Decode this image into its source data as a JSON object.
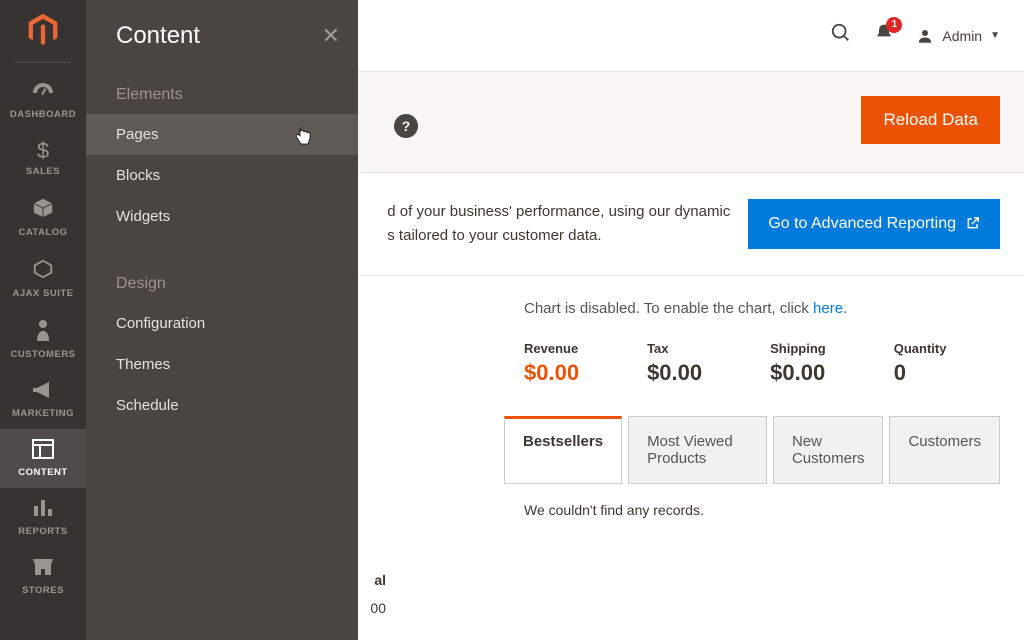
{
  "rail": {
    "items": [
      {
        "label": "DASHBOARD",
        "icon": "◐"
      },
      {
        "label": "SALES",
        "icon": "$"
      },
      {
        "label": "CATALOG",
        "icon": "⬢"
      },
      {
        "label": "AJAX SUITE",
        "icon": "⬡"
      },
      {
        "label": "CUSTOMERS",
        "icon": "👤"
      },
      {
        "label": "MARKETING",
        "icon": "📣"
      },
      {
        "label": "CONTENT",
        "icon": "▦"
      },
      {
        "label": "REPORTS",
        "icon": "▌▌▌"
      },
      {
        "label": "STORES",
        "icon": "🏬"
      }
    ]
  },
  "flyout": {
    "title": "Content",
    "groups": [
      {
        "title": "Elements",
        "items": [
          "Pages",
          "Blocks",
          "Widgets"
        ]
      },
      {
        "title": "Design",
        "items": [
          "Configuration",
          "Themes",
          "Schedule"
        ]
      }
    ],
    "active_item": "Pages"
  },
  "topbar": {
    "notification_count": "1",
    "admin_label": "Admin"
  },
  "actions": {
    "reload_label": "Reload Data"
  },
  "adv": {
    "text_line1": "d of your business' performance, using our dynamic",
    "text_line2": "s tailored to your customer data.",
    "btn_label": "Go to Advanced Reporting"
  },
  "chart_note": {
    "prefix": "Chart is disabled. To enable the chart, click ",
    "link": "here",
    "suffix": "."
  },
  "stats": [
    {
      "label": "Revenue",
      "value": "$0.00",
      "accent": true
    },
    {
      "label": "Tax",
      "value": "$0.00"
    },
    {
      "label": "Shipping",
      "value": "$0.00"
    },
    {
      "label": "Quantity",
      "value": "0"
    }
  ],
  "tabs": {
    "items": [
      "Bestsellers",
      "Most Viewed Products",
      "New Customers",
      "Customers"
    ],
    "active": "Bestsellers",
    "empty": "We couldn't find any records."
  },
  "left_fragment": {
    "header": "al",
    "row": "00"
  }
}
